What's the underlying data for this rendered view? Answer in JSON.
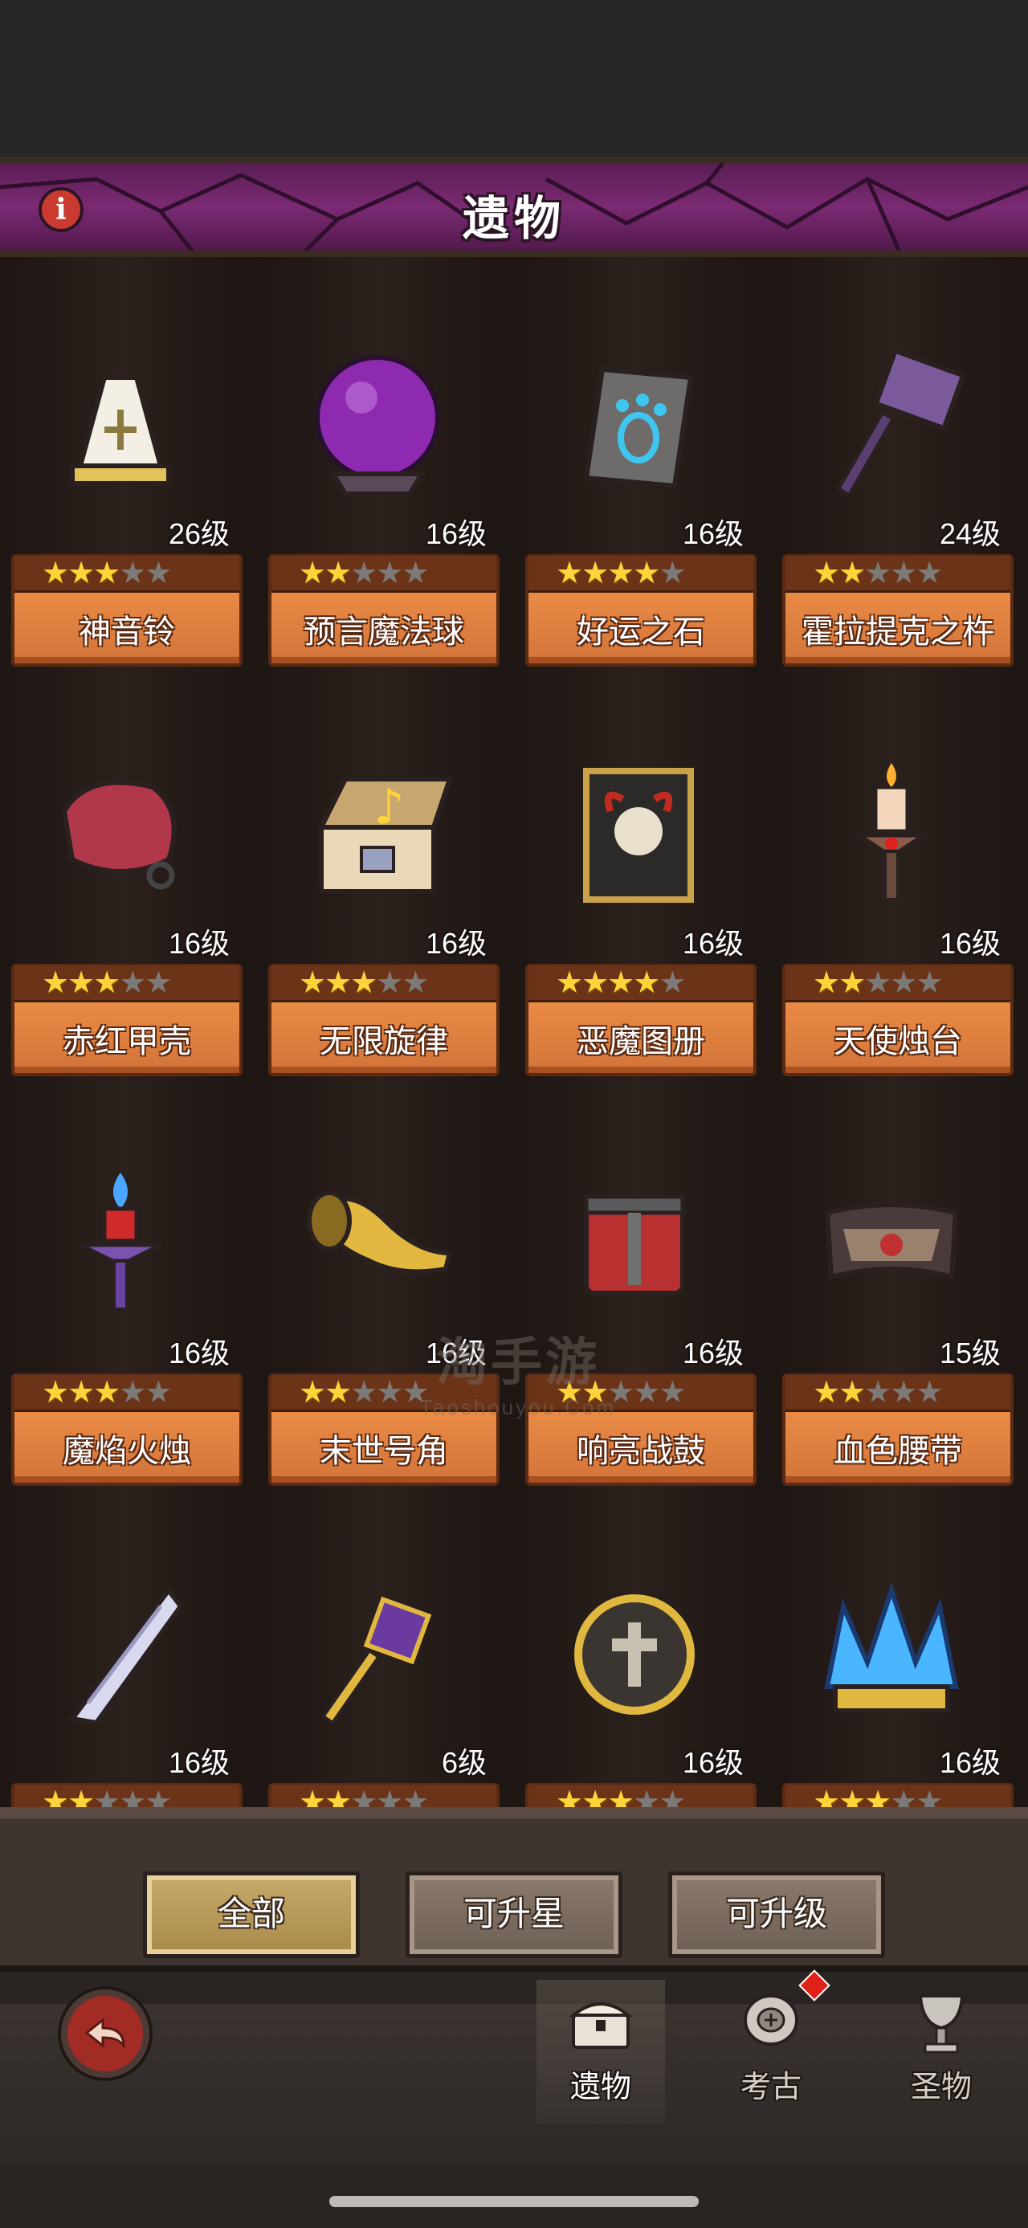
{
  "header": {
    "title": "遗物",
    "info_icon": "info-icon"
  },
  "relics": [
    {
      "name": "神音铃",
      "level": "26级",
      "stars": 3,
      "max_stars": 5,
      "icon": "bell-icon"
    },
    {
      "name": "预言魔法球",
      "level": "16级",
      "stars": 2,
      "max_stars": 5,
      "icon": "crystal-ball-icon"
    },
    {
      "name": "好运之石",
      "level": "16级",
      "stars": 4,
      "max_stars": 5,
      "icon": "paw-stone-icon"
    },
    {
      "name": "霍拉提克之杵",
      "level": "24级",
      "stars": 2,
      "max_stars": 5,
      "icon": "hammer-icon"
    },
    {
      "name": "赤红甲壳",
      "level": "16级",
      "stars": 3,
      "max_stars": 5,
      "icon": "red-shell-icon"
    },
    {
      "name": "无限旋律",
      "level": "16级",
      "stars": 3,
      "max_stars": 5,
      "icon": "music-box-icon"
    },
    {
      "name": "恶魔图册",
      "level": "16级",
      "stars": 4,
      "max_stars": 5,
      "icon": "demon-book-icon"
    },
    {
      "name": "天使烛台",
      "level": "16级",
      "stars": 2,
      "max_stars": 5,
      "icon": "candlestick-icon"
    },
    {
      "name": "魔焰火烛",
      "level": "16级",
      "stars": 3,
      "max_stars": 5,
      "icon": "blue-flame-torch-icon"
    },
    {
      "name": "末世号角",
      "level": "16级",
      "stars": 2,
      "max_stars": 5,
      "icon": "horn-icon"
    },
    {
      "name": "响亮战鼓",
      "level": "16级",
      "stars": 2,
      "max_stars": 5,
      "icon": "war-drum-icon"
    },
    {
      "name": "血色腰带",
      "level": "15级",
      "stars": 2,
      "max_stars": 5,
      "icon": "belt-icon"
    },
    {
      "name": "",
      "level": "16级",
      "stars": 2,
      "max_stars": 5,
      "icon": "blade-icon"
    },
    {
      "name": "",
      "level": "6级",
      "stars": 2,
      "max_stars": 5,
      "icon": "scepter-icon"
    },
    {
      "name": "",
      "level": "16级",
      "stars": 3,
      "max_stars": 5,
      "icon": "cross-emblem-icon"
    },
    {
      "name": "",
      "level": "16级",
      "stars": 3,
      "max_stars": 5,
      "icon": "blue-crown-icon"
    }
  ],
  "watermark": {
    "main": "淘手游",
    "sub": "Taoshouyou.Com"
  },
  "filters": {
    "all": "全部",
    "star_up": "可升星",
    "level_up": "可升级"
  },
  "nav": {
    "relics": "遗物",
    "archaeology": "考古",
    "holy": "圣物"
  },
  "colors": {
    "title_bar": "#7b2a73",
    "plate": "#e98a45",
    "star_on": "#ffd33a",
    "star_off": "#7c7a78"
  }
}
